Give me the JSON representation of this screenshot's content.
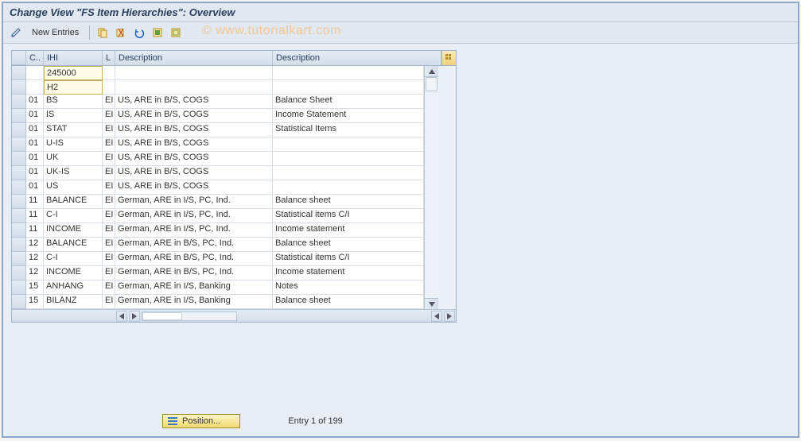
{
  "title": "Change View \"FS Item Hierarchies\": Overview",
  "toolbar": {
    "new_entries_label": "New Entries"
  },
  "watermark": "© www.tutorialkart.com",
  "columns": {
    "c": "C..",
    "ihi": "IHI",
    "l": "L",
    "d1": "Description",
    "d2": "Description"
  },
  "rows": [
    {
      "c": "",
      "ihi": "245000",
      "l": "",
      "d1": "",
      "d2": "",
      "ihi_input": true
    },
    {
      "c": "",
      "ihi": "H2",
      "l": "",
      "d1": "",
      "d2": "",
      "ihi_input": true
    },
    {
      "c": "01",
      "ihi": "BS",
      "l": "EN",
      "lshow": "EI",
      "d1": "US, ARE in B/S, COGS",
      "d2": "Balance Sheet"
    },
    {
      "c": "01",
      "ihi": "IS",
      "l": "EN",
      "lshow": "EI",
      "d1": "US, ARE in B/S, COGS",
      "d2": "Income Statement"
    },
    {
      "c": "01",
      "ihi": "STAT",
      "l": "EN",
      "lshow": "EI",
      "d1": "US, ARE in B/S, COGS",
      "d2": "Statistical Items"
    },
    {
      "c": "01",
      "ihi": "U-IS",
      "l": "EN",
      "lshow": "EI",
      "d1": "US, ARE in B/S, COGS",
      "d2": ""
    },
    {
      "c": "01",
      "ihi": "UK",
      "l": "EN",
      "lshow": "EI",
      "d1": "US, ARE in B/S, COGS",
      "d2": ""
    },
    {
      "c": "01",
      "ihi": "UK-IS",
      "l": "EN",
      "lshow": "EI",
      "d1": "US, ARE in B/S, COGS",
      "d2": ""
    },
    {
      "c": "01",
      "ihi": "US",
      "l": "EN",
      "lshow": "EI",
      "d1": "US, ARE in B/S, COGS",
      "d2": ""
    },
    {
      "c": "11",
      "ihi": "BALANCE",
      "l": "EN",
      "lshow": "EI",
      "d1": "German, ARE in I/S, PC, Ind.",
      "d2": "Balance sheet"
    },
    {
      "c": "11",
      "ihi": "C-I",
      "l": "EN",
      "lshow": "EI",
      "d1": "German, ARE in I/S, PC, Ind.",
      "d2": "Statistical items C/I"
    },
    {
      "c": "11",
      "ihi": "INCOME",
      "l": "EN",
      "lshow": "EI",
      "d1": "German, ARE in I/S, PC, Ind.",
      "d2": "Income statement"
    },
    {
      "c": "12",
      "ihi": "BALANCE",
      "l": "EN",
      "lshow": "EI",
      "d1": "German, ARE in B/S, PC, Ind.",
      "d2": "Balance sheet"
    },
    {
      "c": "12",
      "ihi": "C-I",
      "l": "EN",
      "lshow": "EI",
      "d1": "German, ARE in B/S, PC, Ind.",
      "d2": "Statistical items C/I"
    },
    {
      "c": "12",
      "ihi": "INCOME",
      "l": "EN",
      "lshow": "EI",
      "d1": "German, ARE in B/S, PC, Ind.",
      "d2": "Income statement"
    },
    {
      "c": "15",
      "ihi": "ANHANG",
      "l": "EN",
      "lshow": "EI",
      "d1": "German, ARE in I/S, Banking",
      "d2": "Notes"
    },
    {
      "c": "15",
      "ihi": "BILANZ",
      "l": "EN",
      "lshow": "EI",
      "d1": "German, ARE in I/S, Banking",
      "d2": "Balance sheet"
    }
  ],
  "position_label": "Position...",
  "entry_text": "Entry 1 of 199"
}
